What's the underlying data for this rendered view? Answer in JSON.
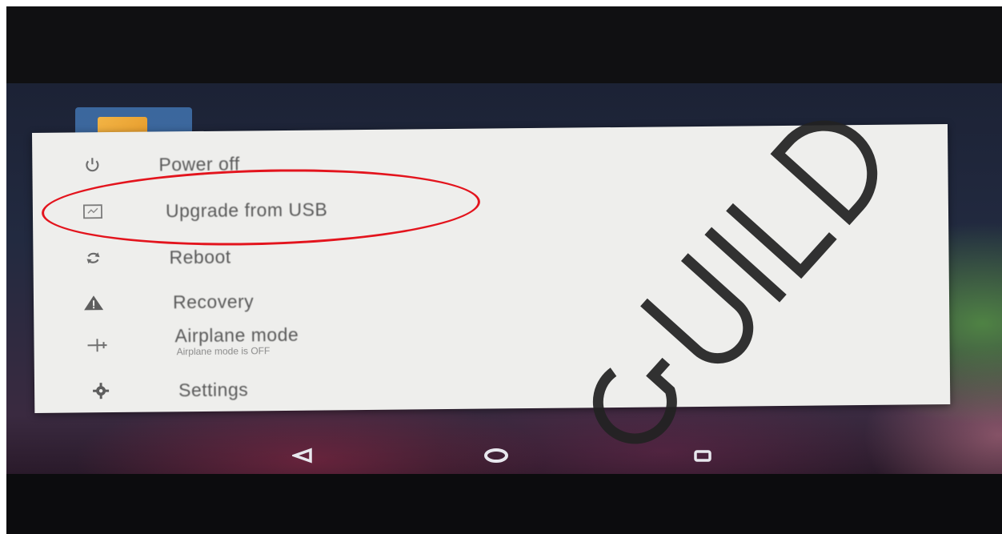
{
  "power_menu": {
    "items": [
      {
        "label": "Power off",
        "icon": "power-icon"
      },
      {
        "label": "Upgrade from USB",
        "icon": "usb-upgrade-icon"
      },
      {
        "label": "Reboot",
        "icon": "reboot-icon"
      },
      {
        "label": "Recovery",
        "icon": "warning-icon"
      },
      {
        "label": "Airplane mode",
        "sublabel": "Airplane mode is OFF",
        "icon": "airplane-icon"
      },
      {
        "label": "Settings",
        "icon": "gear-icon"
      }
    ]
  },
  "nav_bar": {
    "buttons": [
      "back-icon",
      "home-icon",
      "recents-icon"
    ]
  },
  "annotation": {
    "color": "#e3141d",
    "highlighted_item": "Upgrade from USB"
  },
  "watermark": {
    "text": "GUILD"
  }
}
